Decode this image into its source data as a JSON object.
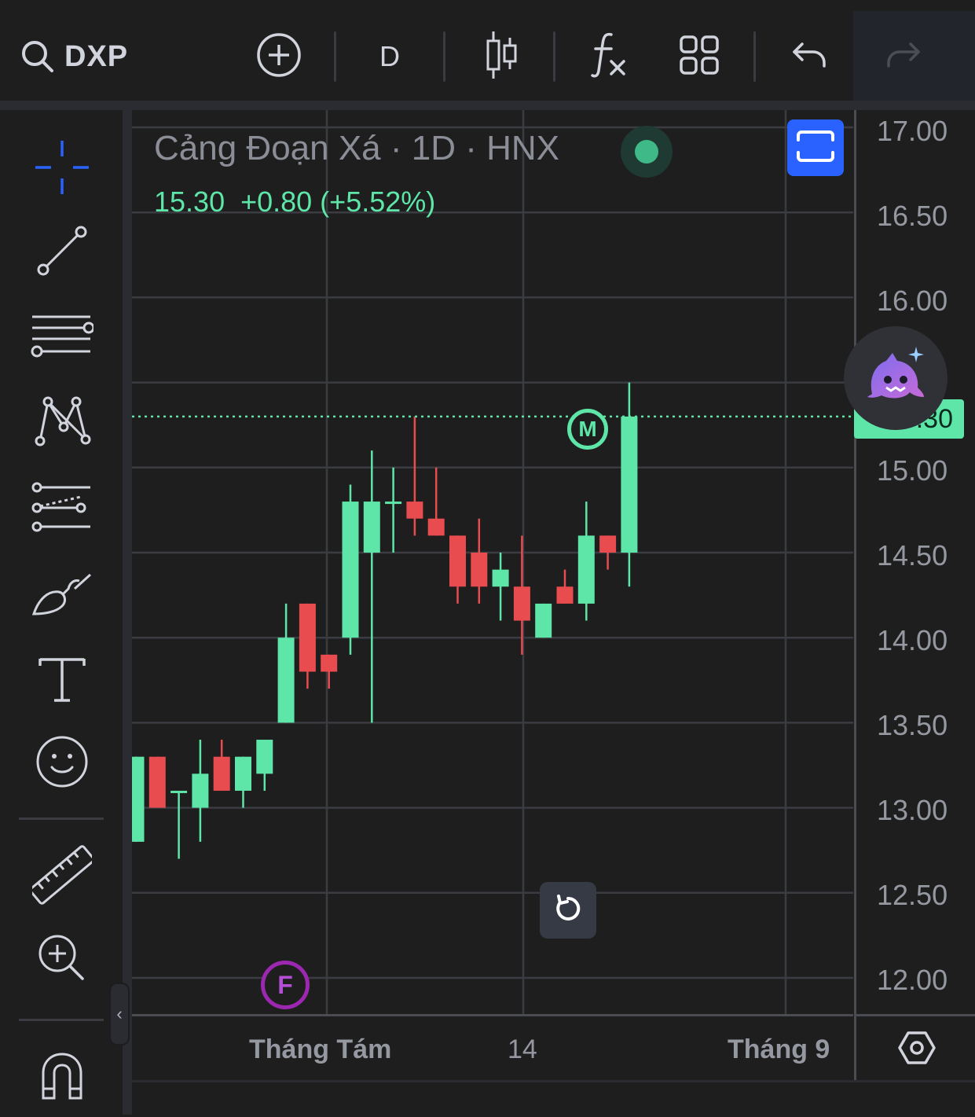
{
  "header": {
    "symbol": "DXP",
    "interval": "D",
    "icons": [
      "search-icon",
      "add-circle-icon",
      "candles-icon",
      "fx-icon",
      "layout-grid-icon",
      "undo-icon",
      "redo-icon"
    ]
  },
  "legend": {
    "title": "Cảng Đoạn Xá · 1D · HNX",
    "price_line": "15.30  +0.80 (+5.52%)"
  },
  "colors": {
    "up": "#5ee6a8",
    "down": "#e84c4f",
    "grid": "#3a3c42",
    "accent": "#2962ff"
  },
  "price_axis": {
    "labels": [
      "17.00",
      "16.50",
      "16.00",
      "15.00",
      "14.50",
      "14.00",
      "13.50",
      "13.00",
      "12.50",
      "12.00"
    ],
    "last_price": "15.30"
  },
  "time_axis": {
    "labels": [
      "Tháng Tám",
      "14",
      "Tháng 9"
    ]
  },
  "markers": {
    "m": "M",
    "f": "F"
  },
  "chart_data": {
    "type": "candlestick",
    "ylim": [
      11.8,
      17.1
    ],
    "candles": [
      {
        "o": 12.8,
        "h": 13.3,
        "l": 12.8,
        "c": 13.3
      },
      {
        "o": 13.3,
        "h": 13.3,
        "l": 13.0,
        "c": 13.0
      },
      {
        "o": 13.1,
        "h": 13.1,
        "l": 12.7,
        "c": 13.1
      },
      {
        "o": 13.0,
        "h": 13.4,
        "l": 12.8,
        "c": 13.2
      },
      {
        "o": 13.3,
        "h": 13.4,
        "l": 13.1,
        "c": 13.1
      },
      {
        "o": 13.1,
        "h": 13.3,
        "l": 13.0,
        "c": 13.3
      },
      {
        "o": 13.2,
        "h": 13.4,
        "l": 13.1,
        "c": 13.4
      },
      {
        "o": 13.5,
        "h": 14.2,
        "l": 13.5,
        "c": 14.0
      },
      {
        "o": 14.2,
        "h": 14.2,
        "l": 13.7,
        "c": 13.8
      },
      {
        "o": 13.9,
        "h": 13.9,
        "l": 13.7,
        "c": 13.8
      },
      {
        "o": 14.0,
        "h": 14.9,
        "l": 13.9,
        "c": 14.8
      },
      {
        "o": 14.5,
        "h": 15.1,
        "l": 13.5,
        "c": 14.8
      },
      {
        "o": 14.8,
        "h": 15.0,
        "l": 14.5,
        "c": 14.8
      },
      {
        "o": 14.8,
        "h": 15.3,
        "l": 14.6,
        "c": 14.7
      },
      {
        "o": 14.7,
        "h": 15.0,
        "l": 14.6,
        "c": 14.6
      },
      {
        "o": 14.6,
        "h": 14.6,
        "l": 14.2,
        "c": 14.3
      },
      {
        "o": 14.5,
        "h": 14.7,
        "l": 14.2,
        "c": 14.3
      },
      {
        "o": 14.3,
        "h": 14.5,
        "l": 14.1,
        "c": 14.4
      },
      {
        "o": 14.3,
        "h": 14.6,
        "l": 13.9,
        "c": 14.1
      },
      {
        "o": 14.0,
        "h": 14.2,
        "l": 14.0,
        "c": 14.2
      },
      {
        "o": 14.3,
        "h": 14.4,
        "l": 14.2,
        "c": 14.2
      },
      {
        "o": 14.2,
        "h": 14.8,
        "l": 14.1,
        "c": 14.6
      },
      {
        "o": 14.6,
        "h": 14.6,
        "l": 14.4,
        "c": 14.5
      },
      {
        "o": 14.5,
        "h": 15.5,
        "l": 14.3,
        "c": 15.3
      }
    ]
  }
}
